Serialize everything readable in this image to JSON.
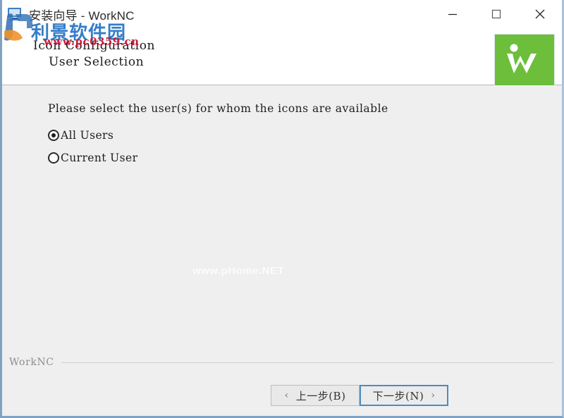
{
  "window": {
    "title": "安装向导 - WorkNC",
    "app_icon": "installer-icon",
    "controls": {
      "minimize": "minimize-icon",
      "maximize": "maximize-icon",
      "close": "close-icon"
    }
  },
  "header": {
    "line1": "Icon Configuration",
    "line2": "User Selection",
    "logo_text": "W",
    "logo_color": "#6cbe3b"
  },
  "main": {
    "prompt": "Please select the user(s) for whom the icons are available",
    "options": [
      {
        "label": "All Users",
        "selected": true
      },
      {
        "label": "Current User",
        "selected": false
      }
    ],
    "watermark": "www.pHome.NET"
  },
  "footer": {
    "brand": "WorkNC",
    "back_button": {
      "chevron": "‹",
      "label": "上一步(B)",
      "focused": false
    },
    "next_button": {
      "label": "下一步(N)",
      "chevron": "›",
      "focused": true
    }
  },
  "overlay_watermark": {
    "chinese": "利景软件园",
    "url": "www.pc0359.cn"
  }
}
